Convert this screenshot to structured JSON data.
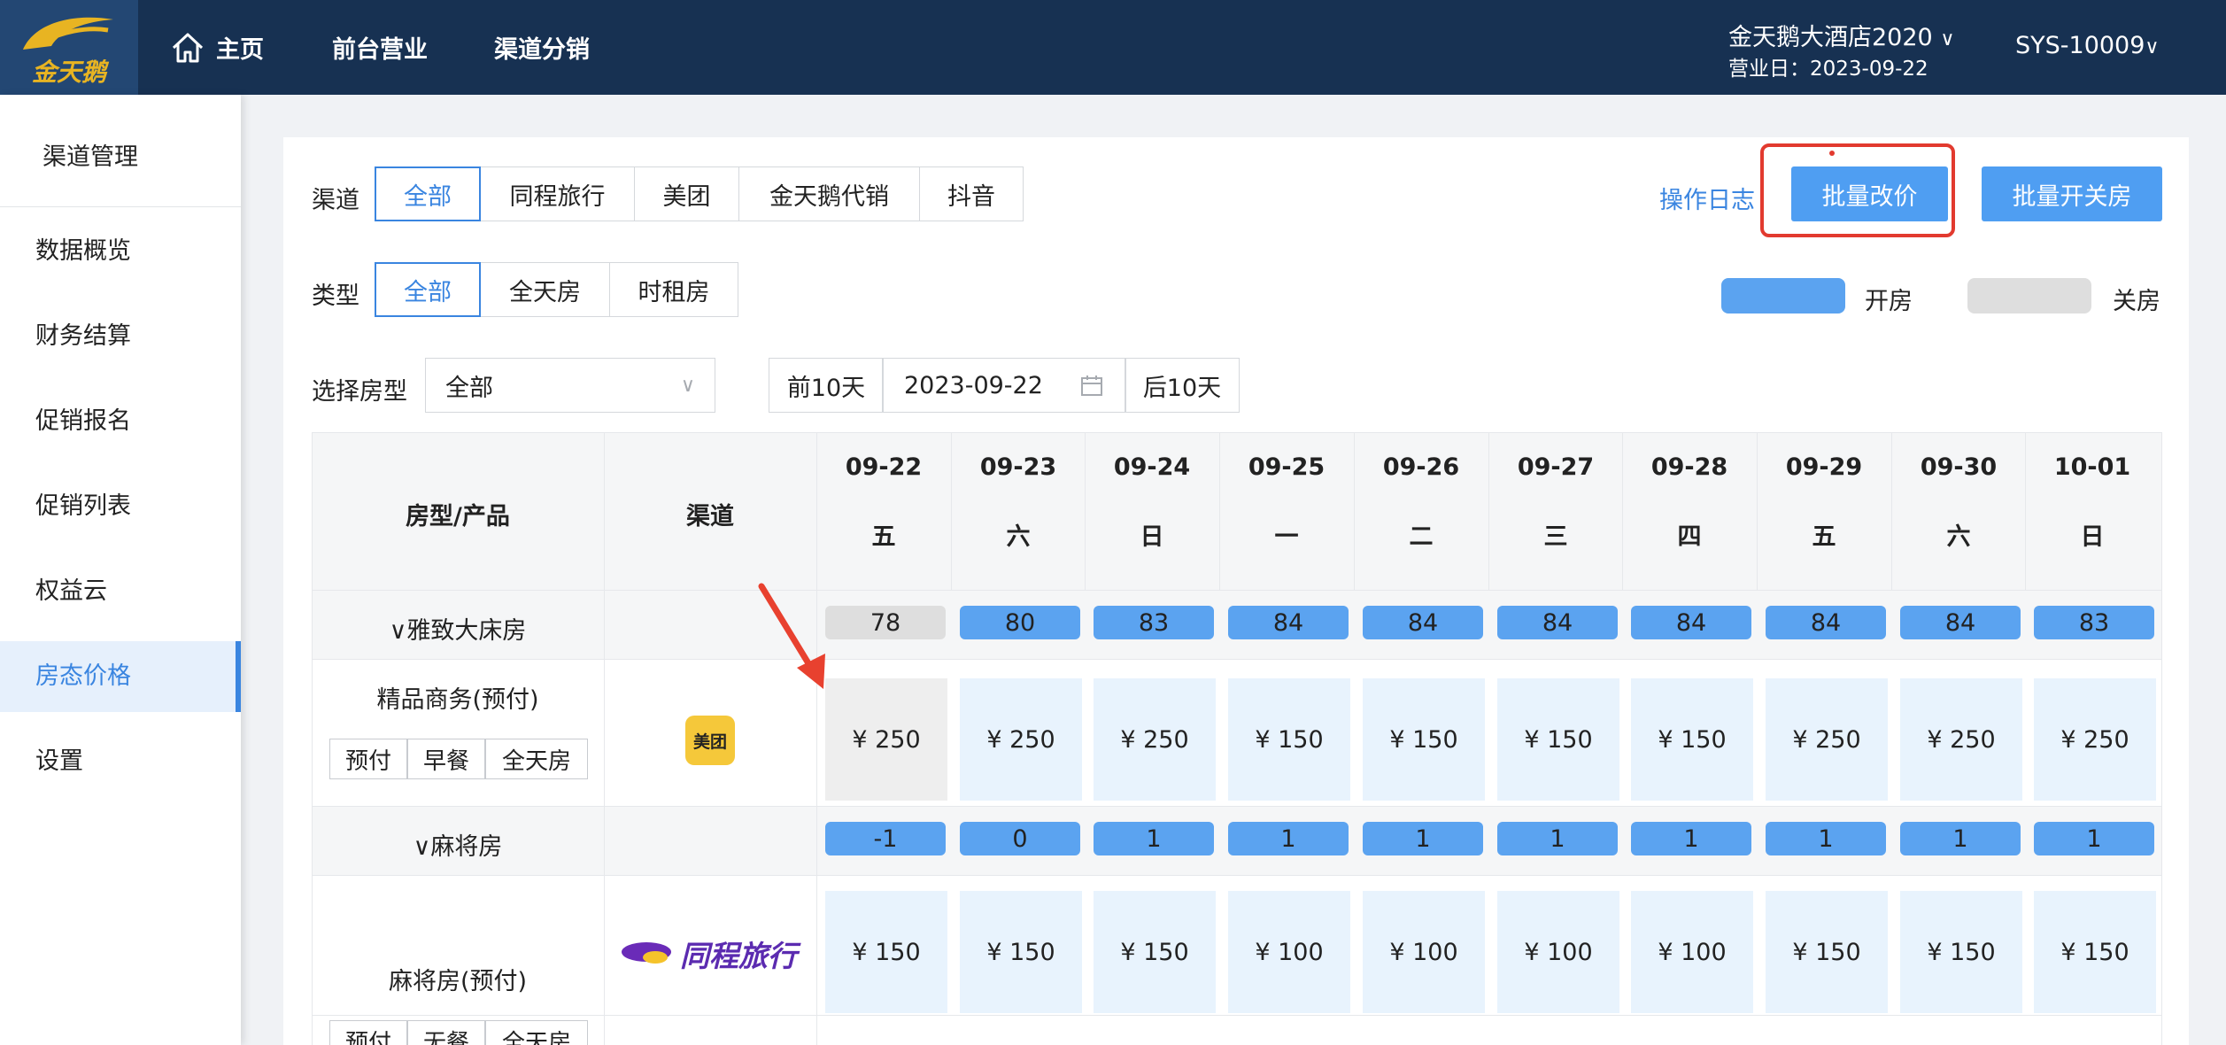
{
  "header": {
    "logo_text": "金天鹅",
    "nav": [
      "主页",
      "前台营业",
      "渠道分销"
    ],
    "hotel_name": "金天鹅大酒店2020",
    "business_date": "营业日：2023-09-22",
    "user": "SYS-10009"
  },
  "sidebar": {
    "title": "渠道管理",
    "items": [
      {
        "label": "数据概览",
        "active": false
      },
      {
        "label": "财务结算",
        "active": false
      },
      {
        "label": "促销报名",
        "active": false
      },
      {
        "label": "促销列表",
        "active": false
      },
      {
        "label": "权益云",
        "active": false
      },
      {
        "label": "房态价格",
        "active": true
      },
      {
        "label": "设置",
        "active": false
      }
    ]
  },
  "filters": {
    "channel_label": "渠道",
    "channels": [
      "全部",
      "同程旅行",
      "美团",
      "金天鹅代销",
      "抖音"
    ],
    "channel_selected": "全部",
    "type_label": "类型",
    "types": [
      "全部",
      "全天房",
      "时租房"
    ],
    "type_selected": "全部",
    "room_type_label": "选择房型",
    "room_type_value": "全部",
    "prev_days": "前10天",
    "date_value": "2023-09-22",
    "next_days": "后10天"
  },
  "actions": {
    "log_link": "操作日志",
    "batch_price": "批量改价",
    "batch_toggle": "批量开关房"
  },
  "legend": {
    "open_label": "开房",
    "closed_label": "关房",
    "open_color": "#5ba3f0",
    "closed_color": "#dedede"
  },
  "table": {
    "col_room": "房型/产品",
    "col_channel": "渠道",
    "dates": [
      {
        "date": "09-22",
        "weekday": "五"
      },
      {
        "date": "09-23",
        "weekday": "六"
      },
      {
        "date": "09-24",
        "weekday": "日"
      },
      {
        "date": "09-25",
        "weekday": "一"
      },
      {
        "date": "09-26",
        "weekday": "二"
      },
      {
        "date": "09-27",
        "weekday": "三"
      },
      {
        "date": "09-28",
        "weekday": "四"
      },
      {
        "date": "09-29",
        "weekday": "五"
      },
      {
        "date": "09-30",
        "weekday": "六"
      },
      {
        "date": "10-01",
        "weekday": "日"
      }
    ],
    "groups": [
      {
        "room_type": "∨雅致大床房",
        "inventory": [
          "78",
          "80",
          "83",
          "84",
          "84",
          "84",
          "84",
          "84",
          "84",
          "83"
        ],
        "inventory_closed": [
          true,
          false,
          false,
          false,
          false,
          false,
          false,
          false,
          false,
          false
        ],
        "product": {
          "name": "精品商务(预付)",
          "tags": [
            "预付",
            "早餐",
            "全天房"
          ],
          "channel": "美团",
          "prices": [
            "¥ 250",
            "¥ 250",
            "¥ 250",
            "¥ 150",
            "¥ 150",
            "¥ 150",
            "¥ 150",
            "¥ 250",
            "¥ 250",
            "¥ 250"
          ],
          "price_closed": [
            true,
            false,
            false,
            false,
            false,
            false,
            false,
            false,
            false,
            false
          ]
        }
      },
      {
        "room_type": "∨麻将房",
        "inventory": [
          "-1",
          "0",
          "1",
          "1",
          "1",
          "1",
          "1",
          "1",
          "1",
          "1"
        ],
        "inventory_closed": [
          false,
          false,
          false,
          false,
          false,
          false,
          false,
          false,
          false,
          false
        ],
        "product": {
          "name": "麻将房(预付)",
          "tags": [
            "预付",
            "无餐",
            "全天房"
          ],
          "channel": "同程旅行",
          "prices": [
            "¥ 150",
            "¥ 150",
            "¥ 150",
            "¥ 100",
            "¥ 100",
            "¥ 100",
            "¥ 100",
            "¥ 150",
            "¥ 150",
            "¥ 150"
          ],
          "price_closed": [
            false,
            false,
            false,
            false,
            false,
            false,
            false,
            false,
            false,
            false
          ]
        }
      }
    ]
  }
}
